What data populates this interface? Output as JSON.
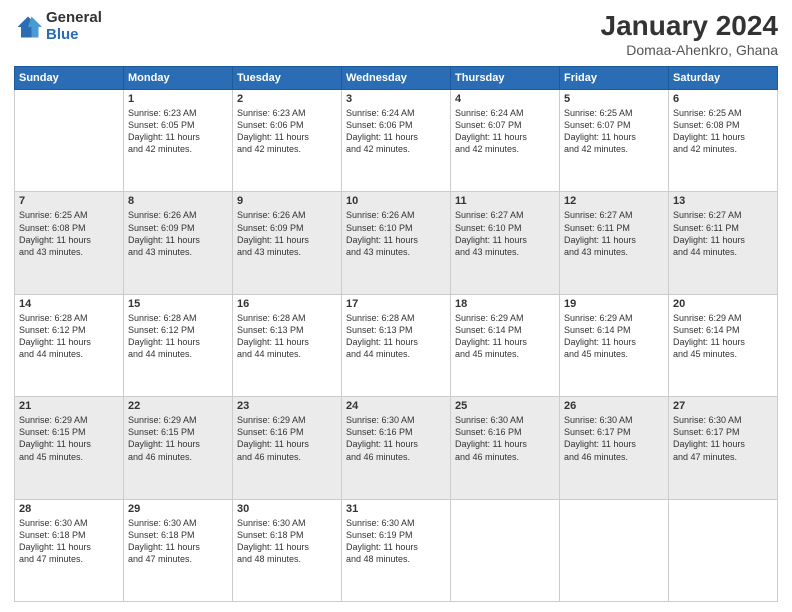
{
  "header": {
    "logo_general": "General",
    "logo_blue": "Blue",
    "main_title": "January 2024",
    "subtitle": "Domaa-Ahenkro, Ghana"
  },
  "days_of_week": [
    "Sunday",
    "Monday",
    "Tuesday",
    "Wednesday",
    "Thursday",
    "Friday",
    "Saturday"
  ],
  "weeks": [
    [
      {
        "day": "",
        "info": ""
      },
      {
        "day": "1",
        "info": "Sunrise: 6:23 AM\nSunset: 6:05 PM\nDaylight: 11 hours\nand 42 minutes."
      },
      {
        "day": "2",
        "info": "Sunrise: 6:23 AM\nSunset: 6:06 PM\nDaylight: 11 hours\nand 42 minutes."
      },
      {
        "day": "3",
        "info": "Sunrise: 6:24 AM\nSunset: 6:06 PM\nDaylight: 11 hours\nand 42 minutes."
      },
      {
        "day": "4",
        "info": "Sunrise: 6:24 AM\nSunset: 6:07 PM\nDaylight: 11 hours\nand 42 minutes."
      },
      {
        "day": "5",
        "info": "Sunrise: 6:25 AM\nSunset: 6:07 PM\nDaylight: 11 hours\nand 42 minutes."
      },
      {
        "day": "6",
        "info": "Sunrise: 6:25 AM\nSunset: 6:08 PM\nDaylight: 11 hours\nand 42 minutes."
      }
    ],
    [
      {
        "day": "7",
        "info": "Sunrise: 6:25 AM\nSunset: 6:08 PM\nDaylight: 11 hours\nand 43 minutes."
      },
      {
        "day": "8",
        "info": "Sunrise: 6:26 AM\nSunset: 6:09 PM\nDaylight: 11 hours\nand 43 minutes."
      },
      {
        "day": "9",
        "info": "Sunrise: 6:26 AM\nSunset: 6:09 PM\nDaylight: 11 hours\nand 43 minutes."
      },
      {
        "day": "10",
        "info": "Sunrise: 6:26 AM\nSunset: 6:10 PM\nDaylight: 11 hours\nand 43 minutes."
      },
      {
        "day": "11",
        "info": "Sunrise: 6:27 AM\nSunset: 6:10 PM\nDaylight: 11 hours\nand 43 minutes."
      },
      {
        "day": "12",
        "info": "Sunrise: 6:27 AM\nSunset: 6:11 PM\nDaylight: 11 hours\nand 43 minutes."
      },
      {
        "day": "13",
        "info": "Sunrise: 6:27 AM\nSunset: 6:11 PM\nDaylight: 11 hours\nand 44 minutes."
      }
    ],
    [
      {
        "day": "14",
        "info": "Sunrise: 6:28 AM\nSunset: 6:12 PM\nDaylight: 11 hours\nand 44 minutes."
      },
      {
        "day": "15",
        "info": "Sunrise: 6:28 AM\nSunset: 6:12 PM\nDaylight: 11 hours\nand 44 minutes."
      },
      {
        "day": "16",
        "info": "Sunrise: 6:28 AM\nSunset: 6:13 PM\nDaylight: 11 hours\nand 44 minutes."
      },
      {
        "day": "17",
        "info": "Sunrise: 6:28 AM\nSunset: 6:13 PM\nDaylight: 11 hours\nand 44 minutes."
      },
      {
        "day": "18",
        "info": "Sunrise: 6:29 AM\nSunset: 6:14 PM\nDaylight: 11 hours\nand 45 minutes."
      },
      {
        "day": "19",
        "info": "Sunrise: 6:29 AM\nSunset: 6:14 PM\nDaylight: 11 hours\nand 45 minutes."
      },
      {
        "day": "20",
        "info": "Sunrise: 6:29 AM\nSunset: 6:14 PM\nDaylight: 11 hours\nand 45 minutes."
      }
    ],
    [
      {
        "day": "21",
        "info": "Sunrise: 6:29 AM\nSunset: 6:15 PM\nDaylight: 11 hours\nand 45 minutes."
      },
      {
        "day": "22",
        "info": "Sunrise: 6:29 AM\nSunset: 6:15 PM\nDaylight: 11 hours\nand 46 minutes."
      },
      {
        "day": "23",
        "info": "Sunrise: 6:29 AM\nSunset: 6:16 PM\nDaylight: 11 hours\nand 46 minutes."
      },
      {
        "day": "24",
        "info": "Sunrise: 6:30 AM\nSunset: 6:16 PM\nDaylight: 11 hours\nand 46 minutes."
      },
      {
        "day": "25",
        "info": "Sunrise: 6:30 AM\nSunset: 6:16 PM\nDaylight: 11 hours\nand 46 minutes."
      },
      {
        "day": "26",
        "info": "Sunrise: 6:30 AM\nSunset: 6:17 PM\nDaylight: 11 hours\nand 46 minutes."
      },
      {
        "day": "27",
        "info": "Sunrise: 6:30 AM\nSunset: 6:17 PM\nDaylight: 11 hours\nand 47 minutes."
      }
    ],
    [
      {
        "day": "28",
        "info": "Sunrise: 6:30 AM\nSunset: 6:18 PM\nDaylight: 11 hours\nand 47 minutes."
      },
      {
        "day": "29",
        "info": "Sunrise: 6:30 AM\nSunset: 6:18 PM\nDaylight: 11 hours\nand 47 minutes."
      },
      {
        "day": "30",
        "info": "Sunrise: 6:30 AM\nSunset: 6:18 PM\nDaylight: 11 hours\nand 48 minutes."
      },
      {
        "day": "31",
        "info": "Sunrise: 6:30 AM\nSunset: 6:19 PM\nDaylight: 11 hours\nand 48 minutes."
      },
      {
        "day": "",
        "info": ""
      },
      {
        "day": "",
        "info": ""
      },
      {
        "day": "",
        "info": ""
      }
    ]
  ]
}
